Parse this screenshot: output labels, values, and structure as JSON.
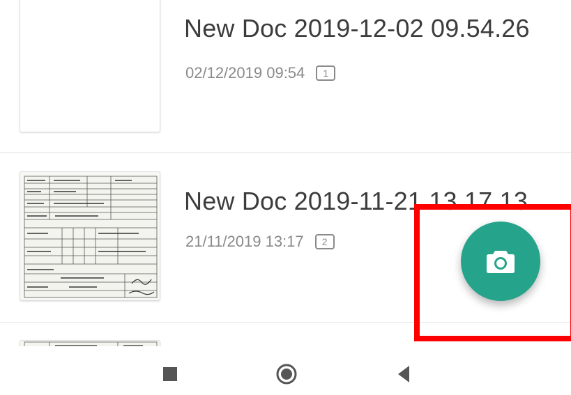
{
  "documents": [
    {
      "title": "New Doc 2019-12-02 09.54.26",
      "date": "02/12/2019 09:54",
      "pages": "1"
    },
    {
      "title": "New Doc 2019-11-21 13.17.13",
      "date": "21/11/2019 13:17",
      "pages": "2"
    }
  ],
  "fab": {
    "icon": "camera-icon"
  },
  "nav": {
    "recent_icon": "square-icon",
    "home_icon": "circle-icon",
    "back_icon": "triangle-left-icon"
  },
  "colors": {
    "accent": "#26a48b",
    "highlight": "#ff0000",
    "title_text": "#3c3c3c",
    "meta_text": "#8a8a8a",
    "divider": "#e3e3e3",
    "nav_icon": "#555555"
  }
}
